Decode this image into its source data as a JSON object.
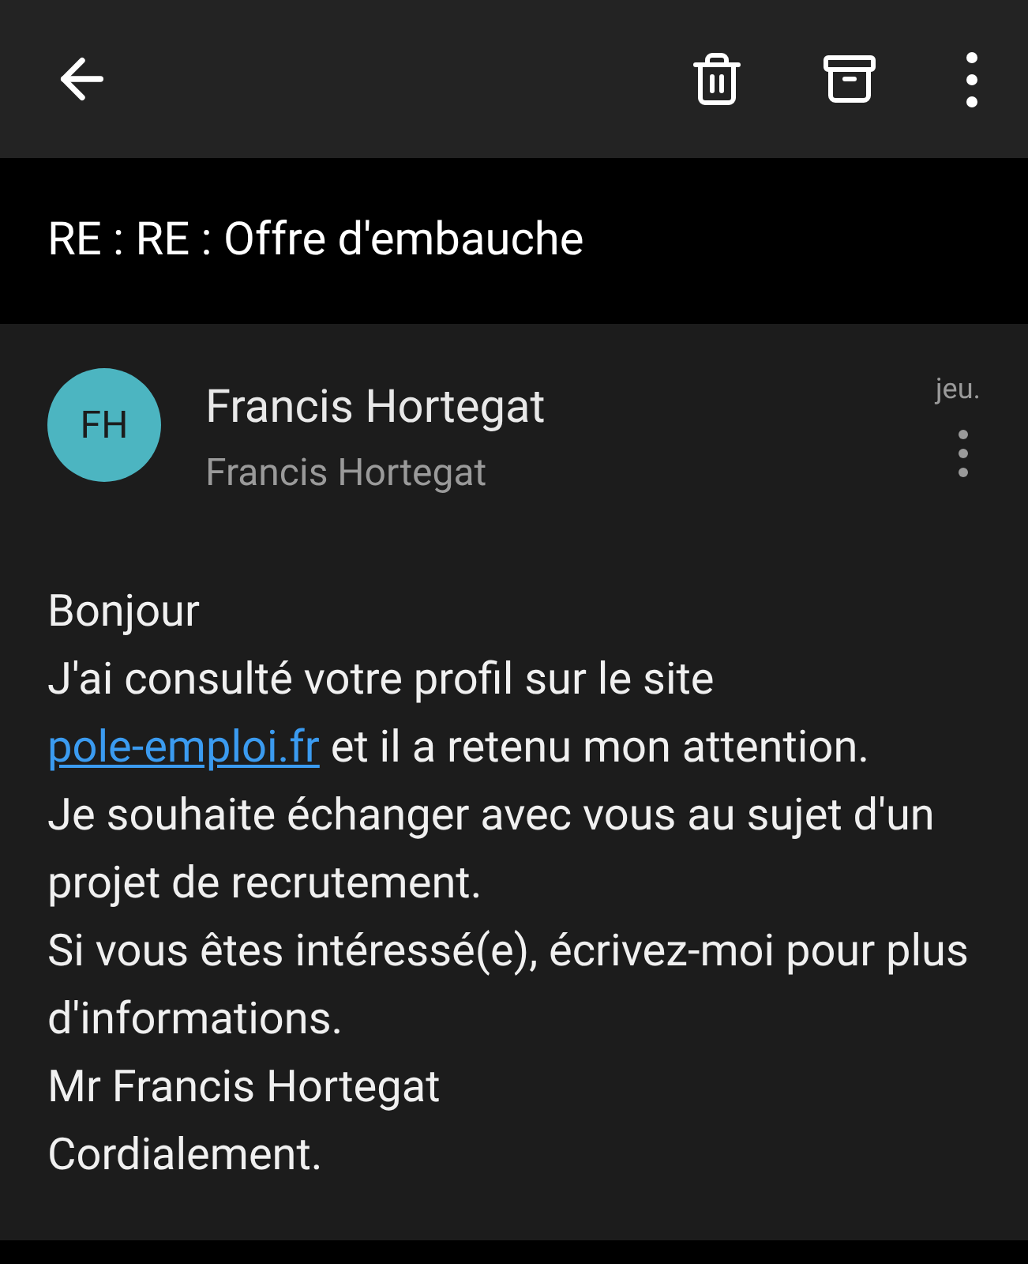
{
  "toolbar": {
    "actions": [
      {
        "kind": "delete"
      },
      {
        "kind": "archive"
      },
      {
        "kind": "more"
      }
    ]
  },
  "subject": "RE : RE : Offre d'embauche",
  "message": {
    "avatar_initials": "FH",
    "color": "#4cb5c1",
    "sender_name": "Francis Hortegat",
    "recipient": "Francis Hortegat",
    "date": "jeu.",
    "body": [
      {
        "kind": "text",
        "text": "Bonjour"
      },
      {
        "kind": "link_line",
        "before": "J'ai consulté votre profil sur le site ",
        "link": "pole-emploi.fr",
        "after": " et il a retenu mon attention."
      },
      {
        "kind": "text",
        "text": "Je souhaite échanger avec vous au sujet d'un projet de recrutement."
      },
      {
        "kind": "text",
        "text": "Si vous êtes intéressé(e), écrivez-moi pour plus d'informations."
      },
      {
        "kind": "text",
        "text": "Mr Francis Hortegat"
      },
      {
        "kind": "text",
        "text": "Cordialement."
      }
    ]
  }
}
